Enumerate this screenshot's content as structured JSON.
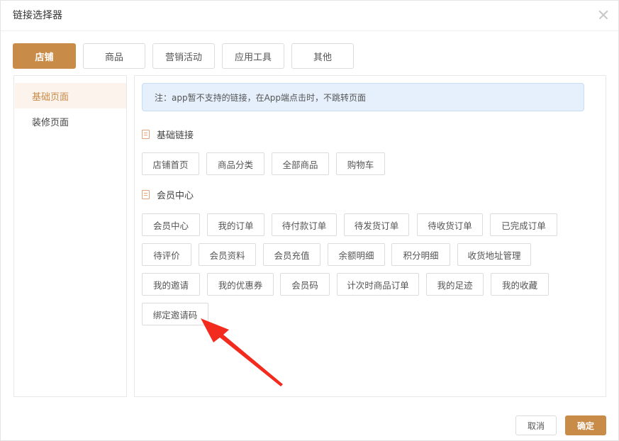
{
  "dialog": {
    "title": "链接选择器"
  },
  "top_tabs": [
    {
      "label": "店铺",
      "active": true
    },
    {
      "label": "商品",
      "active": false
    },
    {
      "label": "营销活动",
      "active": false
    },
    {
      "label": "应用工具",
      "active": false
    },
    {
      "label": "其他",
      "active": false
    }
  ],
  "sidebar": {
    "items": [
      {
        "label": "基础页面",
        "active": true
      },
      {
        "label": "装修页面",
        "active": false
      }
    ]
  },
  "notice": "注：app暂不支持的链接，在App端点击时，不跳转页面",
  "sections": {
    "basic": {
      "title": "基础链接",
      "links": [
        "店铺首页",
        "商品分类",
        "全部商品",
        "购物车"
      ]
    },
    "member": {
      "title": "会员中心",
      "links": [
        "会员中心",
        "我的订单",
        "待付款订单",
        "待发货订单",
        "待收货订单",
        "已完成订单",
        "待评价",
        "会员资料",
        "会员充值",
        "余额明细",
        "积分明细",
        "收货地址管理",
        "我的邀请",
        "我的优惠券",
        "会员码",
        "计次时商品订单",
        "我的足迹",
        "我的收藏",
        "绑定邀请码"
      ]
    }
  },
  "footer": {
    "cancel_label": "取消",
    "ok_label": "确定"
  },
  "colors": {
    "accent": "#c98b48",
    "notice_bg": "#e6f0fc",
    "annotation_arrow": "#f22b1e"
  },
  "icons": {
    "close": "close-icon",
    "section": "document-icon"
  }
}
